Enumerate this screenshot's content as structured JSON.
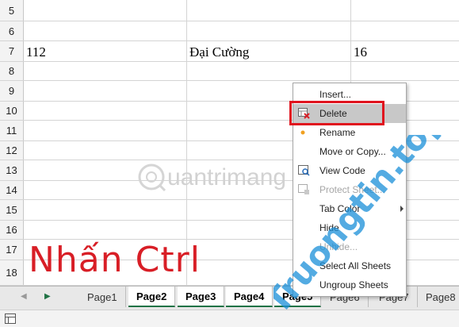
{
  "rows": [
    {
      "num": "5",
      "cells": [
        "",
        "",
        ""
      ]
    },
    {
      "num": "6",
      "cells": [
        "",
        "",
        ""
      ]
    },
    {
      "num": "7",
      "cells": [
        "112",
        "Đại Cường",
        "16"
      ]
    },
    {
      "num": "8",
      "cells": [
        "",
        "",
        ""
      ]
    },
    {
      "num": "9",
      "cells": [
        "",
        "",
        ""
      ]
    },
    {
      "num": "10",
      "cells": [
        "",
        "",
        ""
      ]
    },
    {
      "num": "11",
      "cells": [
        "",
        "",
        ""
      ]
    },
    {
      "num": "12",
      "cells": [
        "",
        "",
        ""
      ]
    },
    {
      "num": "13",
      "cells": [
        "",
        "",
        ""
      ]
    },
    {
      "num": "14",
      "cells": [
        "",
        "",
        ""
      ]
    },
    {
      "num": "15",
      "cells": [
        "",
        "",
        ""
      ]
    },
    {
      "num": "16",
      "cells": [
        "",
        "",
        ""
      ]
    },
    {
      "num": "17",
      "cells": [
        "",
        "",
        ""
      ]
    },
    {
      "num": "18",
      "cells": [
        "",
        "",
        ""
      ]
    }
  ],
  "overlay_text": "Nhấn Ctrl",
  "watermark_text": "uantrimang",
  "brand_text": "Truongtin.top",
  "tabs": [
    {
      "label": "Page1",
      "selected": false
    },
    {
      "label": "Page2",
      "selected": true
    },
    {
      "label": "Page3",
      "selected": true
    },
    {
      "label": "Page4",
      "selected": true
    },
    {
      "label": "Page5",
      "selected": true
    },
    {
      "label": "Page6",
      "selected": false
    },
    {
      "label": "Page7",
      "selected": false
    },
    {
      "label": "Page8",
      "selected": false
    }
  ],
  "context_menu": {
    "items": [
      {
        "label": "Insert...",
        "icon": "",
        "disabled": false,
        "highlighted": false
      },
      {
        "label": "Delete",
        "icon": "delete-sheet-icon",
        "disabled": false,
        "highlighted": true
      },
      {
        "label": "Rename",
        "icon": "bullet-icon",
        "disabled": false,
        "highlighted": false
      },
      {
        "label": "Move or Copy...",
        "icon": "",
        "disabled": false,
        "highlighted": false
      },
      {
        "label": "View Code",
        "icon": "view-code-icon",
        "disabled": false,
        "highlighted": false
      },
      {
        "label": "Protect Sheet...",
        "icon": "protect-sheet-icon",
        "disabled": true,
        "highlighted": false
      },
      {
        "label": "Tab Color",
        "icon": "",
        "disabled": false,
        "highlighted": false,
        "submenu": true
      },
      {
        "label": "Hide",
        "icon": "",
        "disabled": false,
        "highlighted": false
      },
      {
        "label": "Unhide...",
        "icon": "",
        "disabled": true,
        "highlighted": false
      },
      {
        "label": "Select All Sheets",
        "icon": "",
        "disabled": false,
        "highlighted": false
      },
      {
        "label": "Ungroup Sheets",
        "icon": "",
        "disabled": false,
        "highlighted": false
      }
    ]
  },
  "colors": {
    "accent_green": "#217346",
    "highlight_red": "#e0141e",
    "overlay_red": "#d81e26",
    "brand_blue": "#1a8fd8",
    "brand_orange": "#f18a1c"
  }
}
